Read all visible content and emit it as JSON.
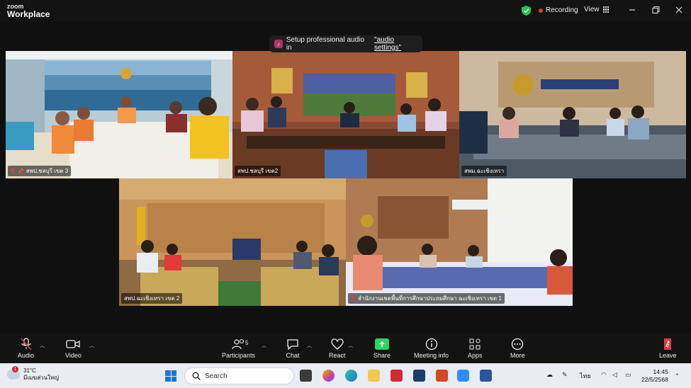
{
  "brand": {
    "line1": "zoom",
    "line2": "Workplace"
  },
  "recording": {
    "label": "Recording"
  },
  "view": {
    "label": "View"
  },
  "notice": {
    "text": "Setup professional audio in",
    "link": "\"audio settings\""
  },
  "tiles": [
    {
      "label": "สพป.ชลบุรี เขต 3",
      "pinned": true
    },
    {
      "label": "สพป.ชลบุรี เขต2",
      "active": true
    },
    {
      "label": "สพม.ฉะเชิงเทรา"
    },
    {
      "label": "สพป.ฉะเชิงเทรา เขต 2"
    },
    {
      "label": "สำนักงานเขตพื้นที่การศึกษาประถมศึกษา ฉะเชิงเทรา เขต 1"
    }
  ],
  "toolbar": {
    "audio": "Audio",
    "video": "Video",
    "participants": "Participants",
    "participants_count": "5",
    "chat": "Chat",
    "react": "React",
    "share": "Share",
    "meeting_info": "Meeting info",
    "apps": "Apps",
    "more": "More",
    "leave": "Leave"
  },
  "taskbar": {
    "weather_temp": "31°C",
    "weather_desc": "มีเมฆส่วนใหญ่",
    "alert_count": "1",
    "search_placeholder": "Search",
    "lang": "ไทย",
    "time": "14:45",
    "date": "22/5/2568"
  },
  "colors": {
    "active_border": "#23d96c",
    "share": "#2bd65a",
    "recording_dot": "#e5383b"
  }
}
